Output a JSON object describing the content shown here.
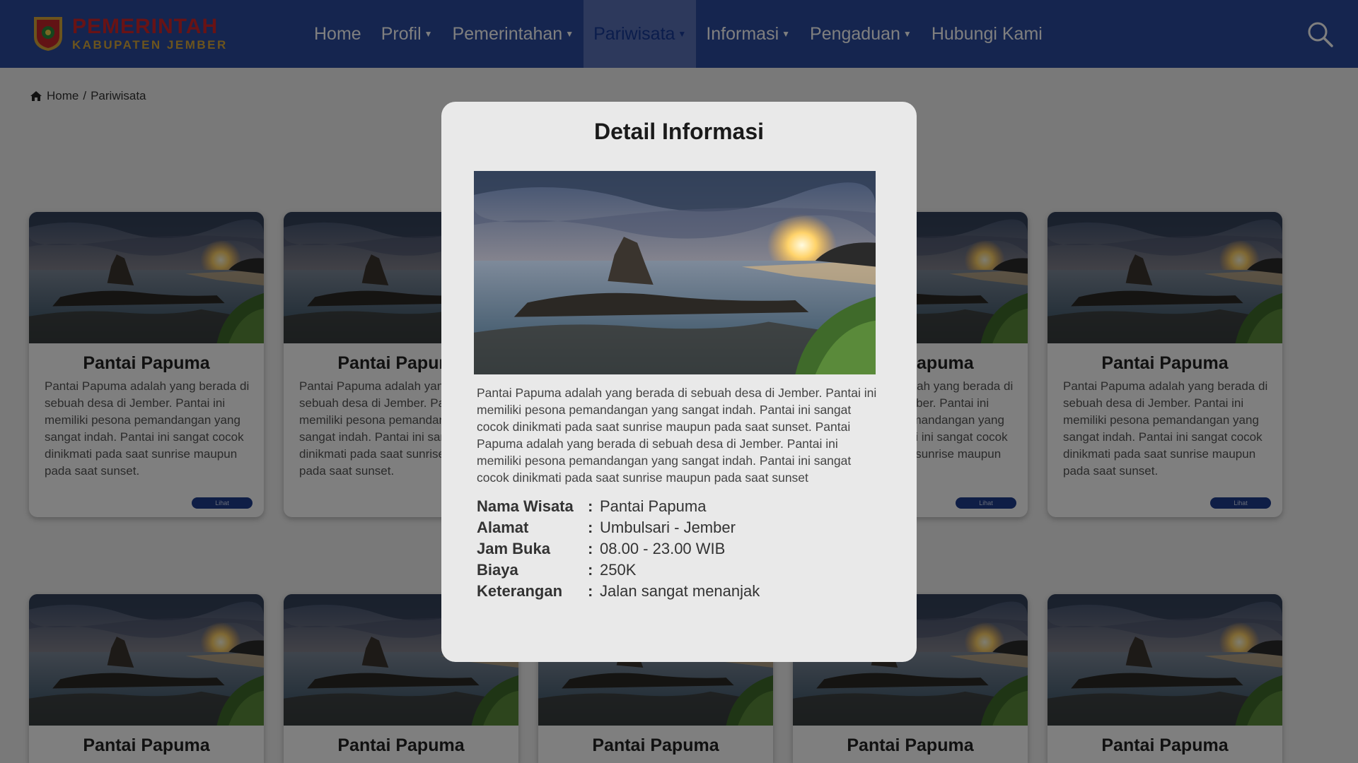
{
  "header": {
    "logo_line1": "PEMERINTAH",
    "logo_line2": "KABUPATEN JEMBER",
    "nav": [
      {
        "label": "Home"
      },
      {
        "label": "Profil"
      },
      {
        "label": "Pemerintahan"
      },
      {
        "label": "Pariwisata"
      },
      {
        "label": "Informasi"
      },
      {
        "label": "Pengaduan"
      },
      {
        "label": "Hubungi Kami"
      }
    ],
    "search_icon": "search-icon"
  },
  "breadcrumb": {
    "home": "Home",
    "separator": "/",
    "current": "Pariwisata"
  },
  "card": {
    "title": "Pantai Papuma",
    "desc": "Pantai Papuma adalah yang berada di sebuah desa di Jember. Pantai ini memiliki pesona pemandangan yang sangat indah. Pantai ini sangat cocok dinikmati pada saat sunrise maupun pada saat sunset.",
    "button": "Lihat"
  },
  "modal": {
    "title": "Detail Informasi",
    "description": "Pantai Papuma adalah yang berada di sebuah desa di Jember. Pantai ini memiliki pesona pemandangan yang sangat indah. Pantai ini sangat cocok dinikmati pada saat sunrise maupun pada saat sunset. Pantai Papuma adalah yang berada di sebuah desa di Jember. Pantai ini memiliki pesona pemandangan yang sangat indah. Pantai ini sangat cocok dinikmati pada saat sunrise maupun pada saat sunset",
    "separator": ":",
    "fields": [
      {
        "label": "Nama Wisata",
        "value": "Pantai Papuma"
      },
      {
        "label": "Alamat",
        "value": "Umbulsari - Jember"
      },
      {
        "label": "Jam Buka",
        "value": "08.00 - 23.00 WIB"
      },
      {
        "label": "Biaya",
        "value": "250K"
      },
      {
        "label": "Keterangan",
        "value": "Jalan sangat menanjak"
      }
    ]
  },
  "colors": {
    "navbar": "#2a4a9e",
    "overlay": "rgba(0,0,0,0.5)",
    "button": "#1e3c8c"
  }
}
